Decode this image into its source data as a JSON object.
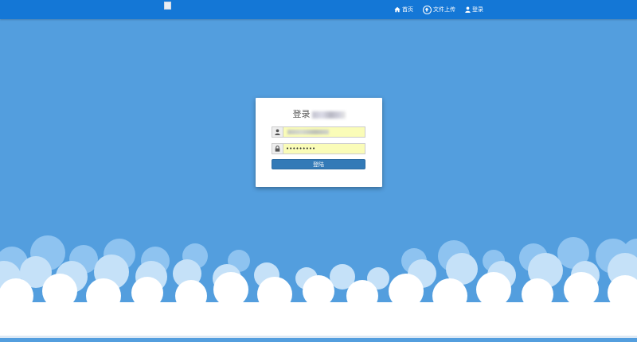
{
  "nav": {
    "home_label": "首页",
    "upload_label": "文件上传",
    "login_label": "登录"
  },
  "icons": {
    "home": "home-icon",
    "upload": "upload-icon",
    "user_nav": "user-icon",
    "user_field": "user-icon",
    "password_field": "lock-icon",
    "brand": "broken-image-icon"
  },
  "login": {
    "title": "登录",
    "password_value": "•••••••••",
    "submit_label": "登陆"
  },
  "colors": {
    "topbar": "#1477d6",
    "background": "#539ede",
    "button": "#337ab7",
    "autofill": "#fafcb8"
  }
}
